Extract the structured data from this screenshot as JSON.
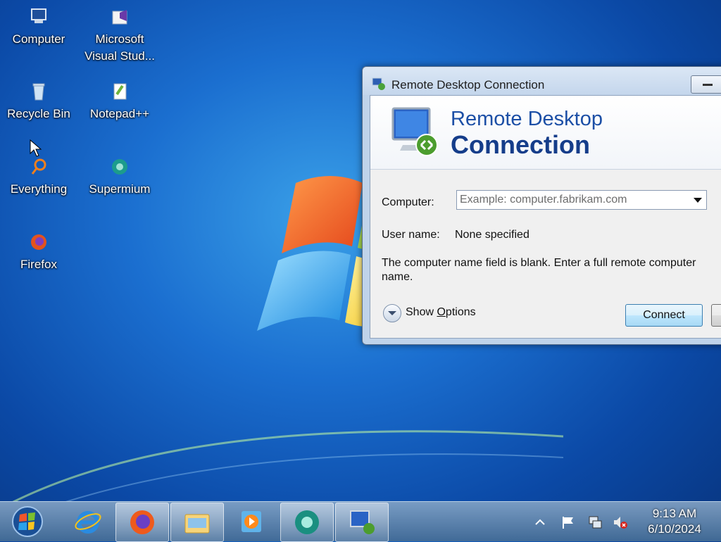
{
  "desktop": {
    "icons": [
      {
        "label": "Computer"
      },
      {
        "label": "Microsoft Visual Stud..."
      },
      {
        "label": "Recycle Bin"
      },
      {
        "label": "Notepad++"
      },
      {
        "label": "Everything"
      },
      {
        "label": "Supermium"
      },
      {
        "label": "Firefox"
      }
    ]
  },
  "dialog": {
    "title": "Remote Desktop Connection",
    "banner_line1": "Remote Desktop",
    "banner_line2": "Connection",
    "computer_label": "Computer:",
    "computer_placeholder": "Example: computer.fabrikam.com",
    "username_label": "User name:",
    "username_value": "None specified",
    "message": "The computer name field is blank. Enter a full remote computer name.",
    "show_options_pre": "Show ",
    "show_options_underlined": "O",
    "show_options_post": "ptions",
    "connect_label": "Connect"
  },
  "taskbar": {
    "time": "9:13 AM",
    "date": "6/10/2024"
  }
}
